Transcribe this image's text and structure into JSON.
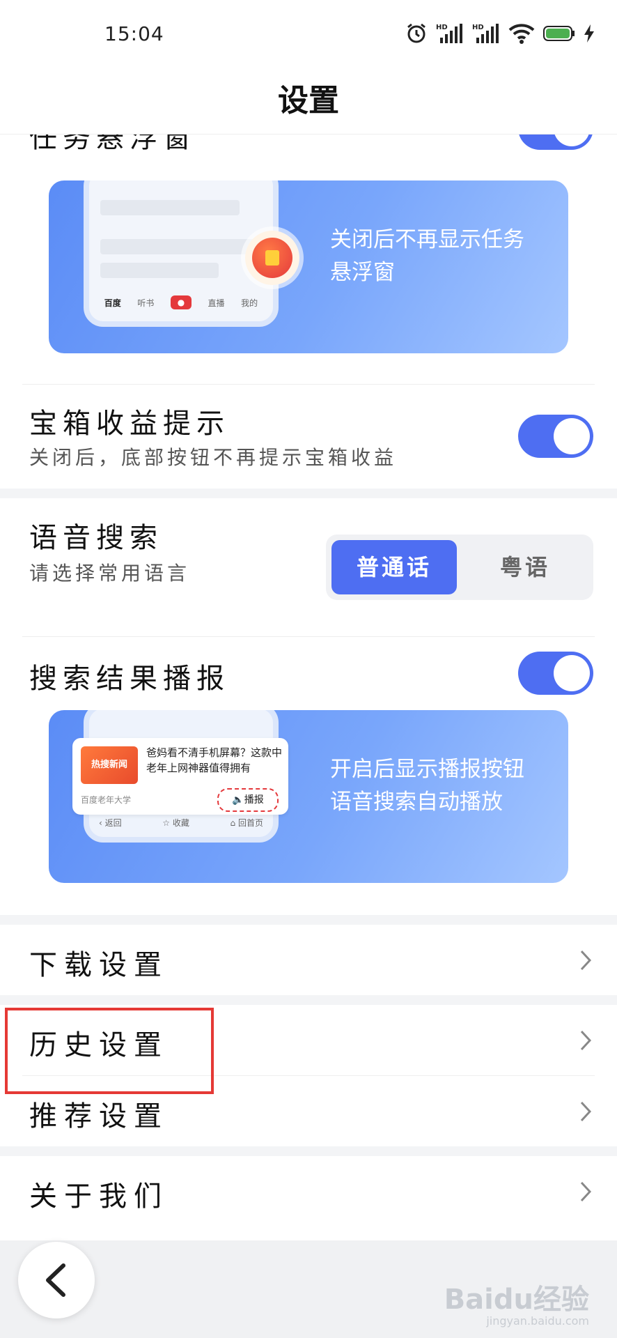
{
  "status_bar": {
    "time": "15:04",
    "icons": [
      "alarm-icon",
      "signal-hd-icon",
      "signal-hd-icon",
      "wifi-icon",
      "battery-icon",
      "charging-icon"
    ]
  },
  "header": {
    "title": "设置"
  },
  "floating_task": {
    "title": "任务悬浮窗",
    "enabled": true,
    "banner_line1": "关闭后不再显示任务",
    "banner_line2": "悬浮窗",
    "phone_tabs": [
      "百度",
      "听书",
      "直播",
      "我的"
    ]
  },
  "treasure": {
    "title": "宝箱收益提示",
    "subtitle": "关闭后，底部按钮不再提示宝箱收益",
    "enabled": true
  },
  "voice_search": {
    "title": "语音搜索",
    "subtitle": "请选择常用语言",
    "options": [
      "普通话",
      "粤语"
    ],
    "selected": "普通话"
  },
  "broadcast": {
    "title": "搜索结果播报",
    "enabled": true,
    "banner_line1": "开启后显示播报按钮",
    "banner_line2": "语音搜索自动播放",
    "card_thumb": "热搜新闻",
    "card_title": "爸妈看不清手机屏幕？这款中老年上网神器值得拥有",
    "card_source": "百度老年大学",
    "card_button": "播报",
    "phone_tabs": [
      "返回",
      "收藏",
      "回首页"
    ]
  },
  "menu": {
    "download": "下载设置",
    "history": "历史设置",
    "recommend": "推荐设置",
    "about": "关于我们"
  },
  "watermark": {
    "main": "Baidu经验",
    "sub": "jingyan.baidu.com"
  },
  "colors": {
    "accent": "#4e6ef2",
    "highlight": "#e53935"
  }
}
